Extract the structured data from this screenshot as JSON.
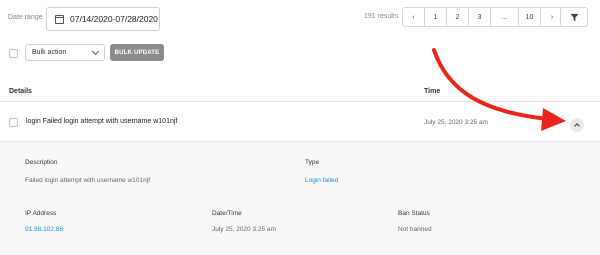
{
  "filters": {
    "date_label": "Date range",
    "date_value": "07/14/2020-07/28/2020",
    "results_text": "191 results"
  },
  "pagination": {
    "prev": "‹",
    "pages": [
      "1",
      "2",
      "3",
      "...",
      "10"
    ],
    "next": "›"
  },
  "bulk": {
    "select_value": "Bulk action",
    "update_label": "BULK UPDATE"
  },
  "table": {
    "headers": {
      "details": "Details",
      "time": "Time"
    },
    "row": {
      "text": "login Failed login attempt with username w101njf",
      "time": "July 25, 2020 3:25 am"
    }
  },
  "details": {
    "description_label": "Description",
    "description_value": "Failed login attempt with username w101njf",
    "type_label": "Type",
    "type_value": "Login failed",
    "ip_label": "IP Address",
    "ip_value": "91.98.102.86",
    "datetime_label": "Date/Time",
    "datetime_value": "July 25, 2020 3:25 am",
    "ban_label": "Ban Status",
    "ban_value": "Not banned"
  },
  "colors": {
    "link": "#1a8fd6",
    "annotation_arrow": "#e8261c",
    "button_gray": "#8c8c8c"
  }
}
